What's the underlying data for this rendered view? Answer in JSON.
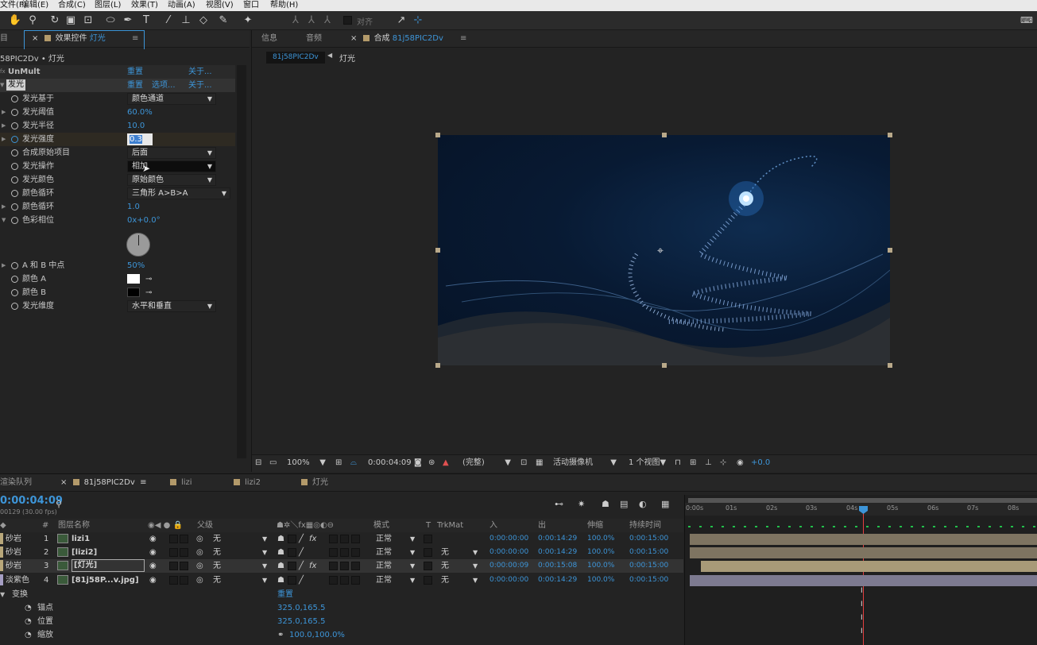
{
  "menu": [
    "文件(F)",
    "编辑(E)",
    "合成(C)",
    "图层(L)",
    "效果(T)",
    "动画(A)",
    "视图(V)",
    "窗口",
    "帮助(H)"
  ],
  "toolbar": {
    "align_label": "对齐"
  },
  "effects_panel": {
    "left_tab": "目",
    "tab_prefix": "效果控件",
    "tab_layer": "灯光",
    "breadcrumb": "58PIC2Dv • 灯光",
    "effects": [
      {
        "name": "UnMult",
        "reset": "重置",
        "about": "关于..."
      },
      {
        "name": "发光",
        "reset": "重置",
        "options": "选项...",
        "about": "关于..."
      }
    ],
    "props": [
      {
        "label": "发光基于",
        "type": "dropdown",
        "value": "颜色通道"
      },
      {
        "label": "发光阈值",
        "type": "value",
        "value": "60.0%",
        "twirl": true
      },
      {
        "label": "发光半径",
        "type": "value",
        "value": "10.0",
        "twirl": true
      },
      {
        "label": "发光强度",
        "type": "edit",
        "value": "0.3",
        "twirl": true
      },
      {
        "label": "合成原始项目",
        "type": "dropdown",
        "value": "后面"
      },
      {
        "label": "发光操作",
        "type": "dropdown",
        "value": "相加"
      },
      {
        "label": "发光颜色",
        "type": "dropdown",
        "value": "原始颜色"
      },
      {
        "label": "颜色循环",
        "type": "dropdown",
        "value": "三角形 A>B>A"
      },
      {
        "label": "颜色循环",
        "type": "value",
        "value": "1.0",
        "twirl": true
      },
      {
        "label": "色彩相位",
        "type": "value",
        "value": "0x+0.0°",
        "twirl": true
      },
      {
        "label": "A 和 B 中点",
        "type": "value",
        "value": "50%",
        "twirl": true
      },
      {
        "label": "颜色 A",
        "type": "color",
        "value": "#ffffff"
      },
      {
        "label": "颜色 B",
        "type": "color",
        "value": "#000000"
      },
      {
        "label": "发光维度",
        "type": "dropdown",
        "value": "水平和垂直"
      }
    ]
  },
  "comp_panel": {
    "tabs": [
      "信息",
      "音频"
    ],
    "comp_tab_prefix": "合成",
    "comp_name": "81j58PIC2Dv",
    "crumb_layer": "灯光",
    "viewer_bar": {
      "zoom": "100%",
      "timecode": "0:00:04:09",
      "quality": "(完整)",
      "camera": "活动摄像机",
      "views": "1 个视图",
      "exposure": "+0.0"
    }
  },
  "timeline": {
    "tabs": [
      "渲染队列",
      "81j58PIC2Dv",
      "lizi",
      "lizi2",
      "灯光"
    ],
    "timecode": "0:00:04:09",
    "fps": "00129 (30.00 fps)",
    "headers": {
      "num": "#",
      "name": "图层名称",
      "parent": "父级",
      "mode": "模式",
      "t": "T",
      "trkmat": "TrkMat",
      "in": "入",
      "out": "出",
      "stretch": "伸缩",
      "duration": "持续时间"
    },
    "ruler": [
      "0:00s",
      "01s",
      "02s",
      "03s",
      "04s",
      "05s",
      "06s",
      "07s",
      "08s"
    ],
    "layers": [
      {
        "label": "砂岩",
        "num": "1",
        "name": "lizi1",
        "parent": "无",
        "mode": "正常",
        "trkmat": "",
        "in": "0:00:00:00",
        "out": "0:00:14:29",
        "stretch": "100.0%",
        "duration": "0:00:15:00",
        "color": "#b8a77a"
      },
      {
        "label": "砂岩",
        "num": "2",
        "name": "[lizi2]",
        "parent": "无",
        "mode": "正常",
        "trkmat": "无",
        "in": "0:00:00:00",
        "out": "0:00:14:29",
        "stretch": "100.0%",
        "duration": "0:00:15:00",
        "color": "#b8a77a"
      },
      {
        "label": "砂岩",
        "num": "3",
        "name": "[灯光]",
        "parent": "无",
        "mode": "正常",
        "trkmat": "无",
        "in": "0:00:00:09",
        "out": "0:00:15:08",
        "stretch": "100.0%",
        "duration": "0:00:15:00",
        "color": "#b8a77a"
      },
      {
        "label": "淡紫色",
        "num": "4",
        "name": "[81j58P...v.jpg]",
        "parent": "无",
        "mode": "正常",
        "trkmat": "无",
        "in": "0:00:00:00",
        "out": "0:00:14:29",
        "stretch": "100.0%",
        "duration": "0:00:15:00",
        "color": "#a59ec3"
      }
    ],
    "transform": {
      "label": "变换",
      "reset": "重置",
      "props": [
        {
          "label": "锚点",
          "value": "325.0,165.5"
        },
        {
          "label": "位置",
          "value": "325.0,165.5"
        },
        {
          "label": "缩放",
          "value": "100.0,100.0%"
        }
      ]
    }
  }
}
